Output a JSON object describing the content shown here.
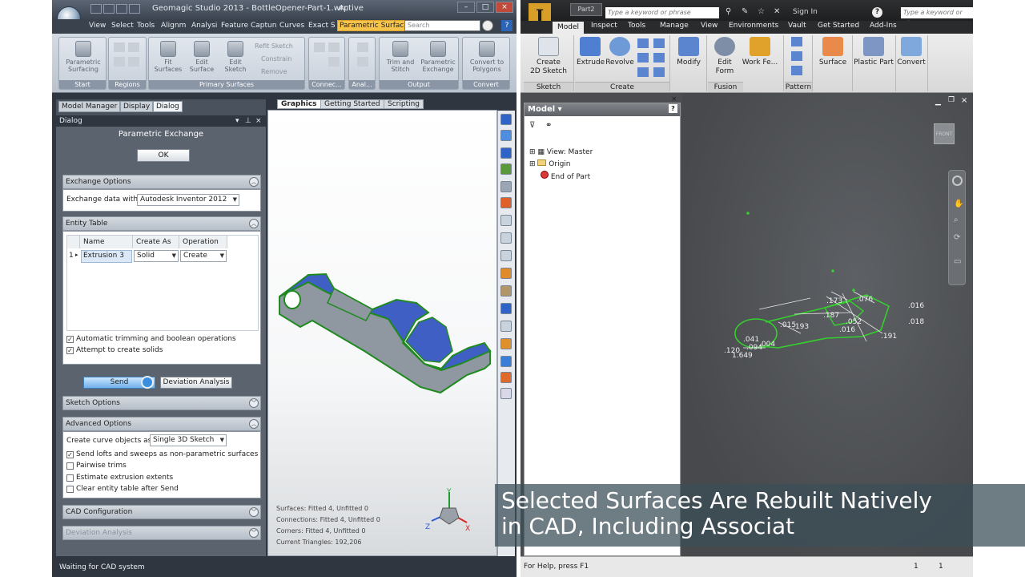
{
  "geomagic": {
    "title": "Geomagic Studio 2013 - BottleOpener-Part-1.wrp",
    "status_active": "Active",
    "tabs": [
      "View",
      "Select",
      "Tools",
      "Alignm",
      "Analysi",
      "Feature",
      "Captun",
      "Curves",
      "Exact S",
      "Parametric Surfaces"
    ],
    "search_placeholder": "Search",
    "ribbon": {
      "groups": [
        {
          "label": "Start",
          "buttons": [
            "Parametric\nSurfacing"
          ]
        },
        {
          "label": "Regions",
          "buttons": []
        },
        {
          "label": "Primary Surfaces",
          "buttons": [
            "Fit\nSurfaces",
            "Edit\nSurface",
            "Edit\nSketch"
          ],
          "small": [
            "Refit Sketch",
            "Constrain",
            "Remove"
          ]
        },
        {
          "label": "Connec...",
          "buttons": []
        },
        {
          "label": "Anal...",
          "buttons": []
        },
        {
          "label": "Output",
          "buttons": [
            "Trim and\nStitch",
            "Parametric\nExchange"
          ]
        },
        {
          "label": "Convert",
          "buttons": [
            "Convert to\nPolygons"
          ]
        }
      ]
    },
    "panel_tabs": [
      "Model Manager",
      "Display",
      "Dialog"
    ],
    "dialog_header": "Dialog",
    "dialog_title": "Parametric Exchange",
    "ok_label": "OK",
    "exchange_options": {
      "header": "Exchange Options",
      "label": "Exchange data with:",
      "value": "Autodesk Inventor 2012"
    },
    "entity_table": {
      "header": "Entity Table",
      "columns": [
        "Name",
        "Create As",
        "Operation"
      ],
      "rows": [
        {
          "index": "1",
          "name": "Extrusion 3",
          "create_as": "Solid",
          "operation": "Create"
        }
      ]
    },
    "checks": [
      {
        "label": "Automatic trimming and boolean operations",
        "checked": true
      },
      {
        "label": "Attempt to create solids",
        "checked": true
      }
    ],
    "send_label": "Send",
    "deviation_button": "Deviation Analysis",
    "sketch_options_header": "Sketch Options",
    "advanced_options": {
      "header": "Advanced Options",
      "label": "Create curve objects as:",
      "value": "Single 3D Sketch",
      "checks": [
        {
          "label": "Send lofts and sweeps as non-parametric surfaces",
          "checked": true
        },
        {
          "label": "Pairwise trims",
          "checked": false
        },
        {
          "label": "Estimate extrusion extents",
          "checked": false
        },
        {
          "label": "Clear entity table after Send",
          "checked": false
        }
      ]
    },
    "cad_config_header": "CAD Configuration",
    "deviation_header": "Deviation Analysis",
    "status": "Waiting for CAD system",
    "viewport_tabs": [
      "Graphics",
      "Getting Started",
      "Scripting"
    ],
    "stats": [
      "Surfaces: Fitted 4, Unfitted 0",
      "Connections: Fitted 4, Unfitted 0",
      "Corners: Fitted 4, Unfitted 0",
      "Current Triangles: 192,206"
    ],
    "triad": {
      "x": "X",
      "y": "Y",
      "z": "Z"
    }
  },
  "inventor": {
    "doc_tab": "Part2",
    "keyword_placeholder": "Type a keyword or phrase",
    "sign_in": "Sign In",
    "help": "?",
    "tabs": [
      "Model",
      "Inspect",
      "Tools",
      "Manage",
      "View",
      "Environments",
      "Vault",
      "Get Started",
      "Add-Ins"
    ],
    "ribbon": {
      "create_sketch": "Create\n2D Sketch",
      "extrude": "Extrude",
      "revolve": "Revolve",
      "modify": "Modify",
      "edit_form": "Edit\nForm",
      "work_features": "Work Fe...",
      "surface": "Surface",
      "plastic_part": "Plastic Part",
      "convert": "Convert",
      "panels": [
        "Sketch",
        "Create",
        "Fusion",
        "Pattern"
      ]
    },
    "browser": {
      "title": "Model",
      "items": [
        "View: Master",
        "Origin",
        "End of Part"
      ]
    },
    "dimensions": [
      ".173",
      ".076",
      ".016",
      ".018",
      ".193",
      ".015",
      ".187",
      ".016",
      ".191",
      ".041",
      ".094",
      ".004",
      ".120",
      "1.649",
      ".052"
    ],
    "status": "For Help, press F1",
    "status_nums": [
      "1",
      "1"
    ],
    "home_label": "FRONT"
  },
  "caption": {
    "line1": "Selected Surfaces Are Rebuilt Natively",
    "line2": "in CAD, Including Associat"
  },
  "colors": {
    "part_blue": "#3f5fc4",
    "part_grey": "#8f97a1",
    "part_edge": "#1f8a1f",
    "sketch_green": "#34d02c"
  }
}
